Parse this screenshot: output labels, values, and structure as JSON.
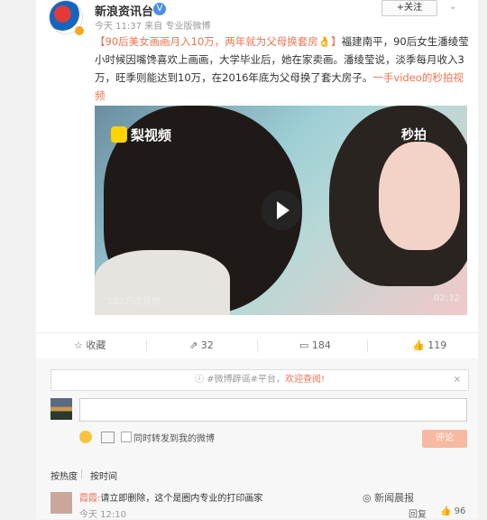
{
  "account": {
    "name": "新浪资讯台",
    "verified_badge": "V",
    "meta": "今天 11:37 来自 专业版微博",
    "follow_label": "+关注",
    "chevron": "⌄"
  },
  "post": {
    "topic": "【90后美女画画月入10万，两年就为父母换套房👌】",
    "body": "福建南平，90后女生潘绫莹小时候因嘴馋喜欢上画画，大学毕业后，她在家卖画。潘绫莹说，淡季每月收入3万，旺季则能达到10万，在2016年底为父母换了套大房子。",
    "link": "一手video的秒拍视频"
  },
  "video": {
    "logo": "梨视频",
    "brand": "秒拍",
    "views": "182万次播放",
    "duration": "02:32"
  },
  "actions": {
    "favorite": "收藏",
    "repost": "32",
    "comment": "184",
    "like": "119"
  },
  "comment_box": {
    "notice_prefix": "#微博辟谣#平台，",
    "notice_link": "欢迎查阅!",
    "notice_close": "×",
    "placeholder": "",
    "also_repost": "同时转发到我的微博",
    "submit": "评论"
  },
  "sort": {
    "hot": "按热度",
    "time": "按时间"
  },
  "comments": [
    {
      "user": "霞霞:",
      "text": "请立即删除，这个是圈内专业的打印画家",
      "time": "今天 12:10",
      "reply": "回复",
      "likes": "96"
    }
  ],
  "watermark": "新闻晨报",
  "colors": {
    "accent": "#eb7350",
    "verified": "#4a90e2"
  }
}
